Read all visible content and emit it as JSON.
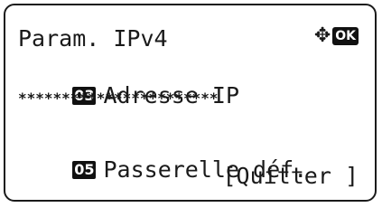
{
  "screen": {
    "title": "Param. IPv4",
    "nav_icon": "four-way-arrow-icon",
    "ok_label": "OK",
    "items": [
      {
        "number": "03",
        "label": "Adresse IP"
      },
      {
        "number": "05",
        "label": "Passerelle déf."
      }
    ],
    "masked_value": "***********************",
    "quit_label": "[Quitter ]"
  }
}
